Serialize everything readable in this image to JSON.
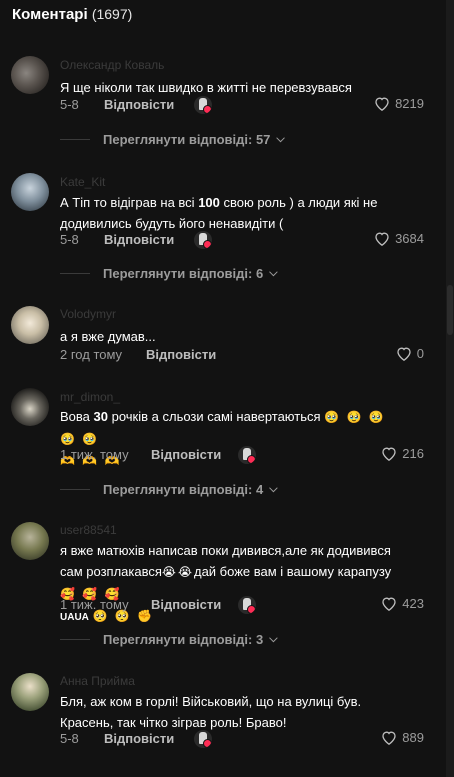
{
  "header": {
    "title": "Коментарі",
    "count": "(1697)"
  },
  "reply_label": "Відповісти",
  "comments": [
    {
      "username": "Олександр Коваль",
      "text": "Я ще ніколи так швидко в житті не перевзувався",
      "date": "5-8",
      "likes": "8219",
      "replies": "Переглянути відповіді: 57"
    },
    {
      "username": "Kate_Kit",
      "text_parts": [
        "А Тіп то відіграв на всі ",
        "100",
        " свою роль ) а люди які не додивились будуть його ненавидіти ("
      ],
      "date": "5-8",
      "likes": "3684",
      "replies": "Переглянути відповіді: 6"
    },
    {
      "username": "Volodymyr",
      "text": "а я вже думав...",
      "date": "2 год тому",
      "likes": "0"
    },
    {
      "username": "mr_dimon_",
      "text_parts": [
        "Вова ",
        "30",
        " рочків а сльози самі навертаються"
      ],
      "emoji_line1": "🥹 🥹 🥹 🥹 🥹",
      "emoji_line2": "🫶 🫶 🫶",
      "date": "1 тиж. тому",
      "likes": "216",
      "replies": "Переглянути відповіді: 4"
    },
    {
      "username": "user88541",
      "text": "я вже матюхів написав поки дивився,але як додивився сам розплакався",
      "emoji_a": "😭",
      "emoji_b": "😭",
      "text2": "дай боже вам і вашому карапузу",
      "emoji_c": "🥰 🥰 🥰",
      "small": "UAUA",
      "emoji_d": "🥺 🥺 ✊",
      "date": "1 тиж. тому",
      "likes": "423",
      "replies": "Переглянути відповіді: 3"
    },
    {
      "username": "Анна Прийма",
      "text": "Бля, аж ком в горлі! Військовий, що на вулиці був. Красень, так чітко зіграв роль! Браво!",
      "date": "5-8",
      "likes": "889"
    }
  ]
}
